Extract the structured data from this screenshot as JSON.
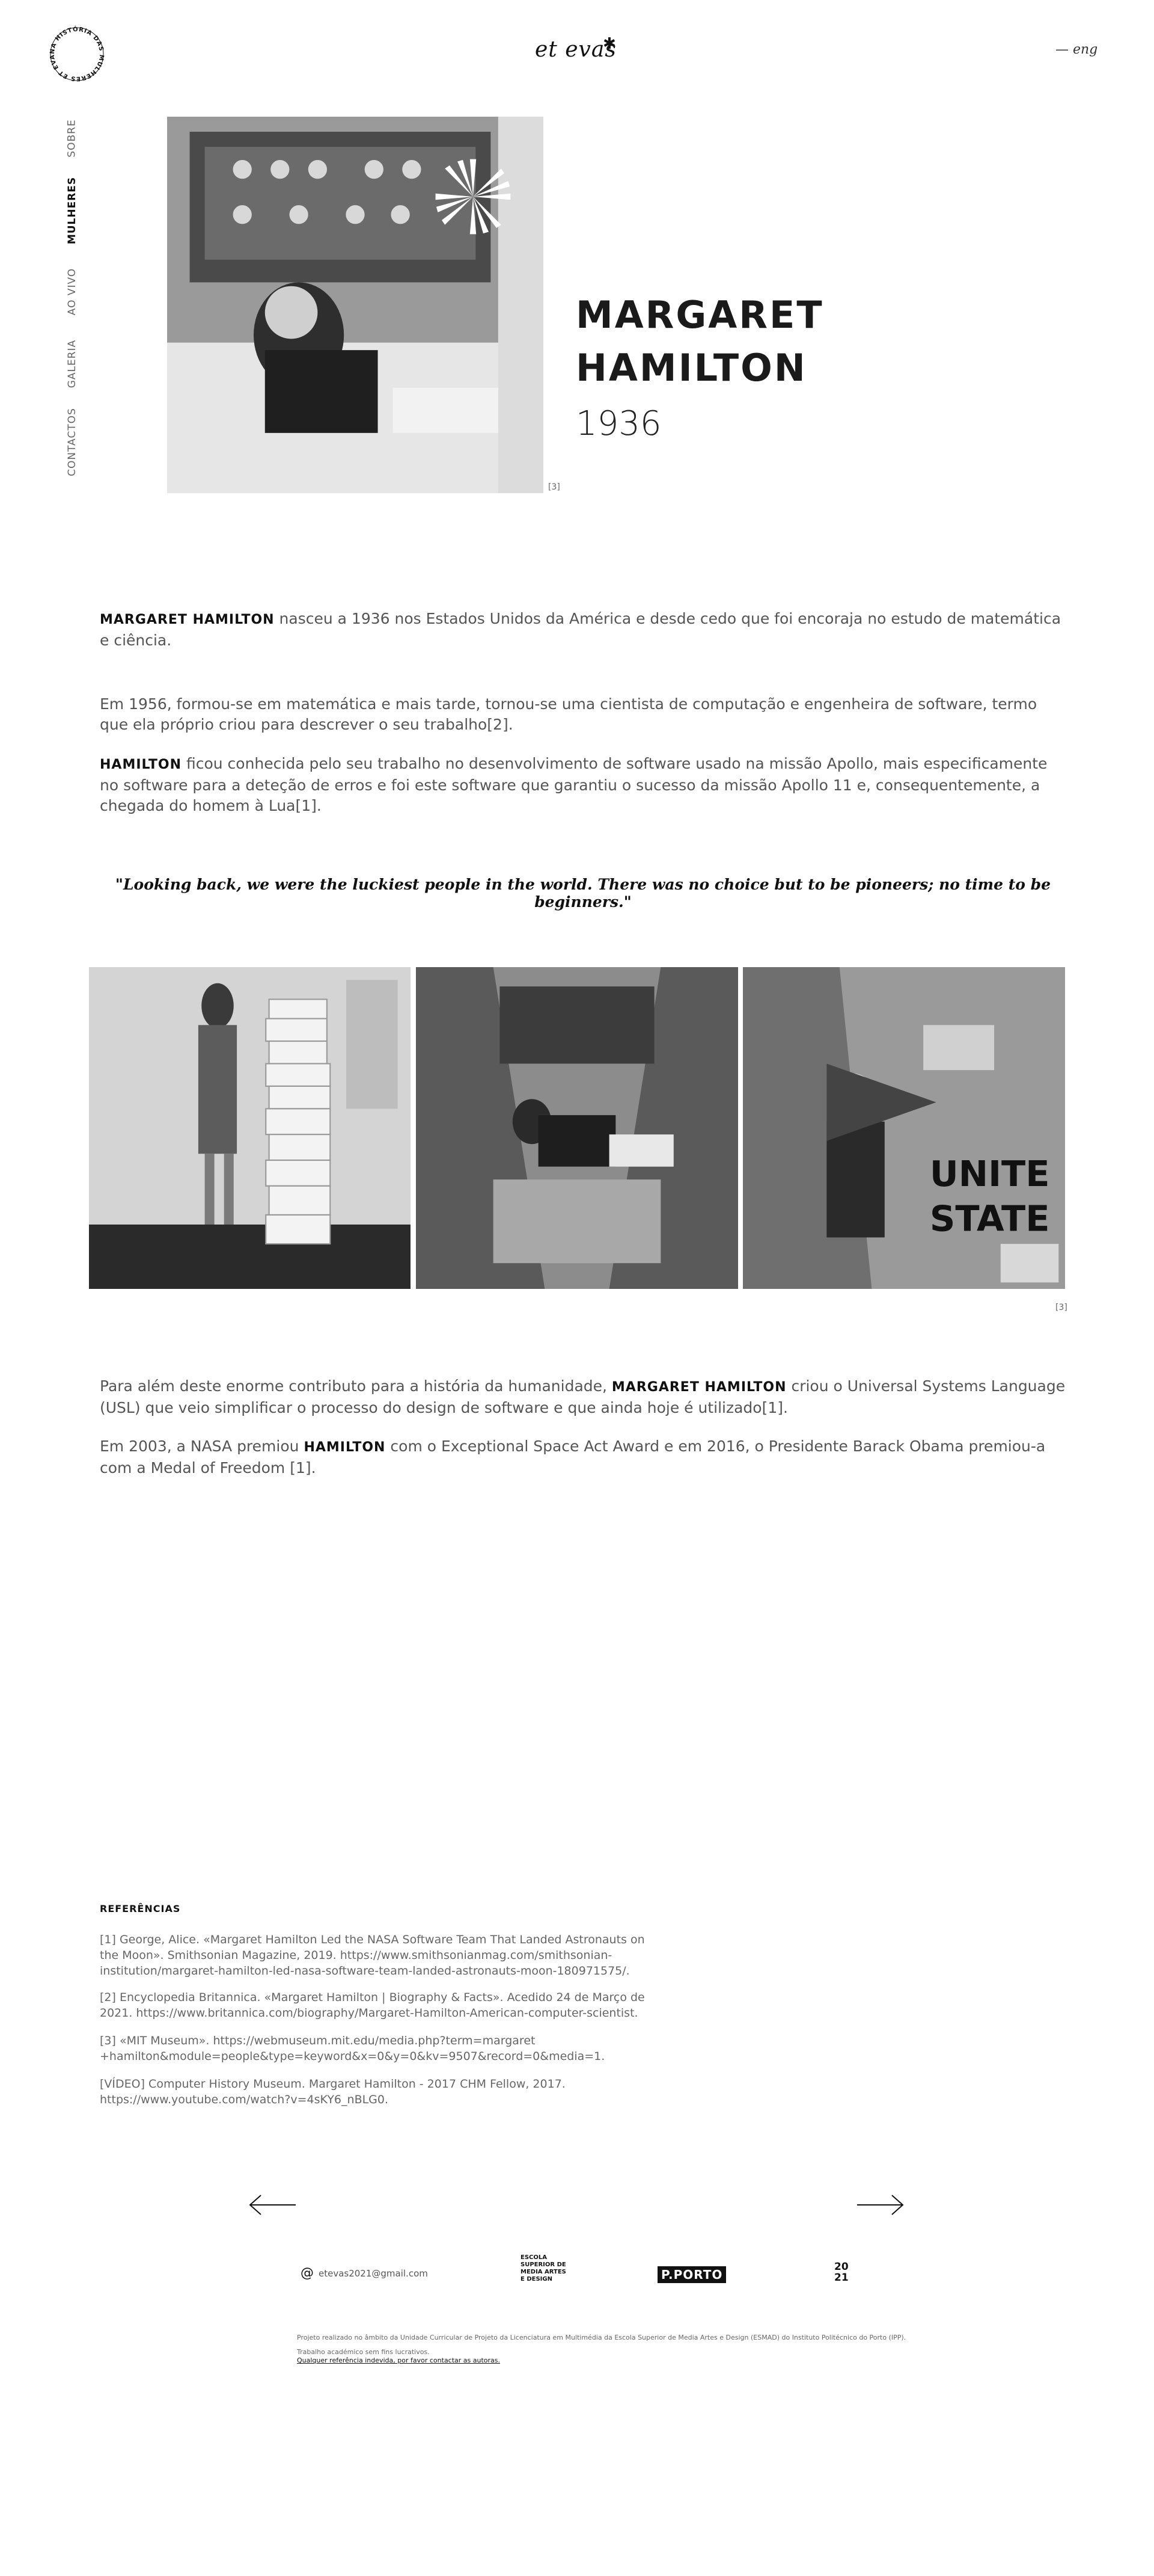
{
  "header": {
    "logo_ring_text": "NA HISTÓRIA DAS MULHERES ET EVAS",
    "brand": "et evas",
    "brand_star": "✱",
    "lang": "— eng"
  },
  "nav": {
    "items": [
      {
        "label": "SOBRE"
      },
      {
        "label": "MULHERES"
      },
      {
        "label": "AO VIVO"
      },
      {
        "label": "GALERIA"
      },
      {
        "label": "CONTACTOS"
      }
    ]
  },
  "hero": {
    "name_line1": "MARGARET",
    "name_line2": "HAMILTON",
    "year": "1936",
    "credit": "[3]"
  },
  "body": {
    "p1_name": "MARGARET HAMILTON",
    "p1_text": " nasceu a 1936 nos Estados Unidos da América e desde cedo que foi encoraja no estudo de matemática e ciência.",
    "p2_text": "Em 1956, formou-se em matemática e mais tarde, tornou-se uma cientista de computação e engenheira de software, termo que ela próprio criou para descrever o seu trabalho[2].",
    "p3_name": "HAMILTON",
    "p3_text": " ficou conhecida pelo seu trabalho no desenvolvimento de software usado na missão Apollo, mais especificamente no software para a deteção de erros e foi este software que garantiu o sucesso da missão Apollo 11 e, consequentemente, a chegada do homem à Lua[1].",
    "quote": "\"Looking back, we were the luckiest people in the world. There was no choice but to be pioneers; no time to be beginners.\"",
    "gallery_credit": "[3]",
    "p4_pre": "Para além deste enorme contributo para a história da humanidade, ",
    "p4_name": "MARGARET HAMILTON",
    "p4_post": " criou o Universal Systems Language (USL) que veio simplificar o processo do design de software e que ainda hoje é utilizado[1].",
    "p5_pre": "Em 2003, a NASA premiou ",
    "p5_name": "HAMILTON",
    "p5_post": " com o Exceptional Space Act Award e em 2016, o Presidente Barack Obama premiou-a com a Medal of Freedom [1]."
  },
  "references": {
    "title": "REFERÊNCIAS",
    "items": [
      "[1] George, Alice. «Margaret Hamilton Led the NASA Software Team That Landed Astronauts on the Moon». Smithsonian Magazine, 2019. https://www.smithsonianmag.com/smithsonian-institution/margaret-hamilton-led-nasa-software-team-landed-astronauts-moon-180971575/.",
      "[2] Encyclopedia Britannica. «Margaret Hamilton | Biography & Facts». Acedido 24 de Março de 2021. https://www.britannica.com/biography/Margaret-Hamilton-American-computer-scientist.",
      "[3] «MIT Museum». https://webmuseum.mit.edu/media.php?term=margaret +hamilton&module=people&type=keyword&x=0&y=0&kv=9507&record=0&media=1.",
      "[VÍDEO] Computer History Museum. Margaret Hamilton - 2017 CHM Fellow, 2017. https://www.youtube.com/watch?v=4sKY6_nBLG0."
    ]
  },
  "footer": {
    "email": "etevas2021@gmail.com",
    "esmad": "ESCOLA SUPERIOR DE MEDIA ARTES E DESIGN",
    "pporto": "P.PORTO",
    "year_top": "20",
    "year_bottom": "21",
    "note": "Projeto realizado no âmbito da Unidade Curricular de Projeto da Licenciatura em Multimédia da Escola Superior de Media Artes e Design (ESMAD) do Instituto Politécnico do Porto (IPP).",
    "note2": "Trabalho académico sem fins lucrativos.",
    "link": "Qualquer referência indevida, por favor contactar as autoras."
  }
}
